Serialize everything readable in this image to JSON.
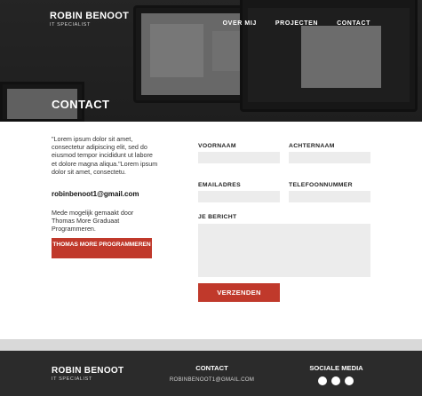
{
  "header": {
    "brand_name": "ROBIN BENOOT",
    "brand_subtitle": "IT SPECIALIST",
    "nav": [
      "OVER MIJ",
      "PROJECTEN",
      "CONTACT"
    ],
    "hero_title": "CONTACT"
  },
  "main": {
    "intro_text": "\"Lorem ipsum dolor sit amet, consectetur adipiscing elit, sed do eiusmod tempor incididunt ut labore et dolore magna aliqua.\"Lorem ipsum dolor sit amet, consectetu.",
    "email": "robinbenoot1@gmail.com",
    "credit_text": "Mede mogelijk gemaakt door Thomas More Graduaat Programmeren.",
    "cta_label": "THOMAS MORE PROGRAMMEREN"
  },
  "form": {
    "first_name_label": "VOORNAAM",
    "first_name_value": "",
    "last_name_label": "ACHTERNAAM",
    "last_name_value": "",
    "email_label": "EMAILADRES",
    "email_value": "",
    "phone_label": "TELEFOONNUMMER",
    "phone_value": "",
    "message_label": "JE BERICHT",
    "message_value": "",
    "submit_label": "VERZENDEN"
  },
  "footer": {
    "brand_name": "ROBIN BENOOT",
    "brand_subtitle": "IT SPECIALIST",
    "contact_title": "CONTACT",
    "contact_email": "ROBINBENOOT1@GMAIL.COM",
    "social_title": "SOCIALE MEDIA",
    "social_icons": [
      "social-icon",
      "social-icon",
      "social-icon"
    ]
  },
  "colors": {
    "accent": "#c0392b",
    "footer_bg": "#2b2b2b",
    "divider": "#d9d9d9",
    "field_bg": "#ececec"
  }
}
